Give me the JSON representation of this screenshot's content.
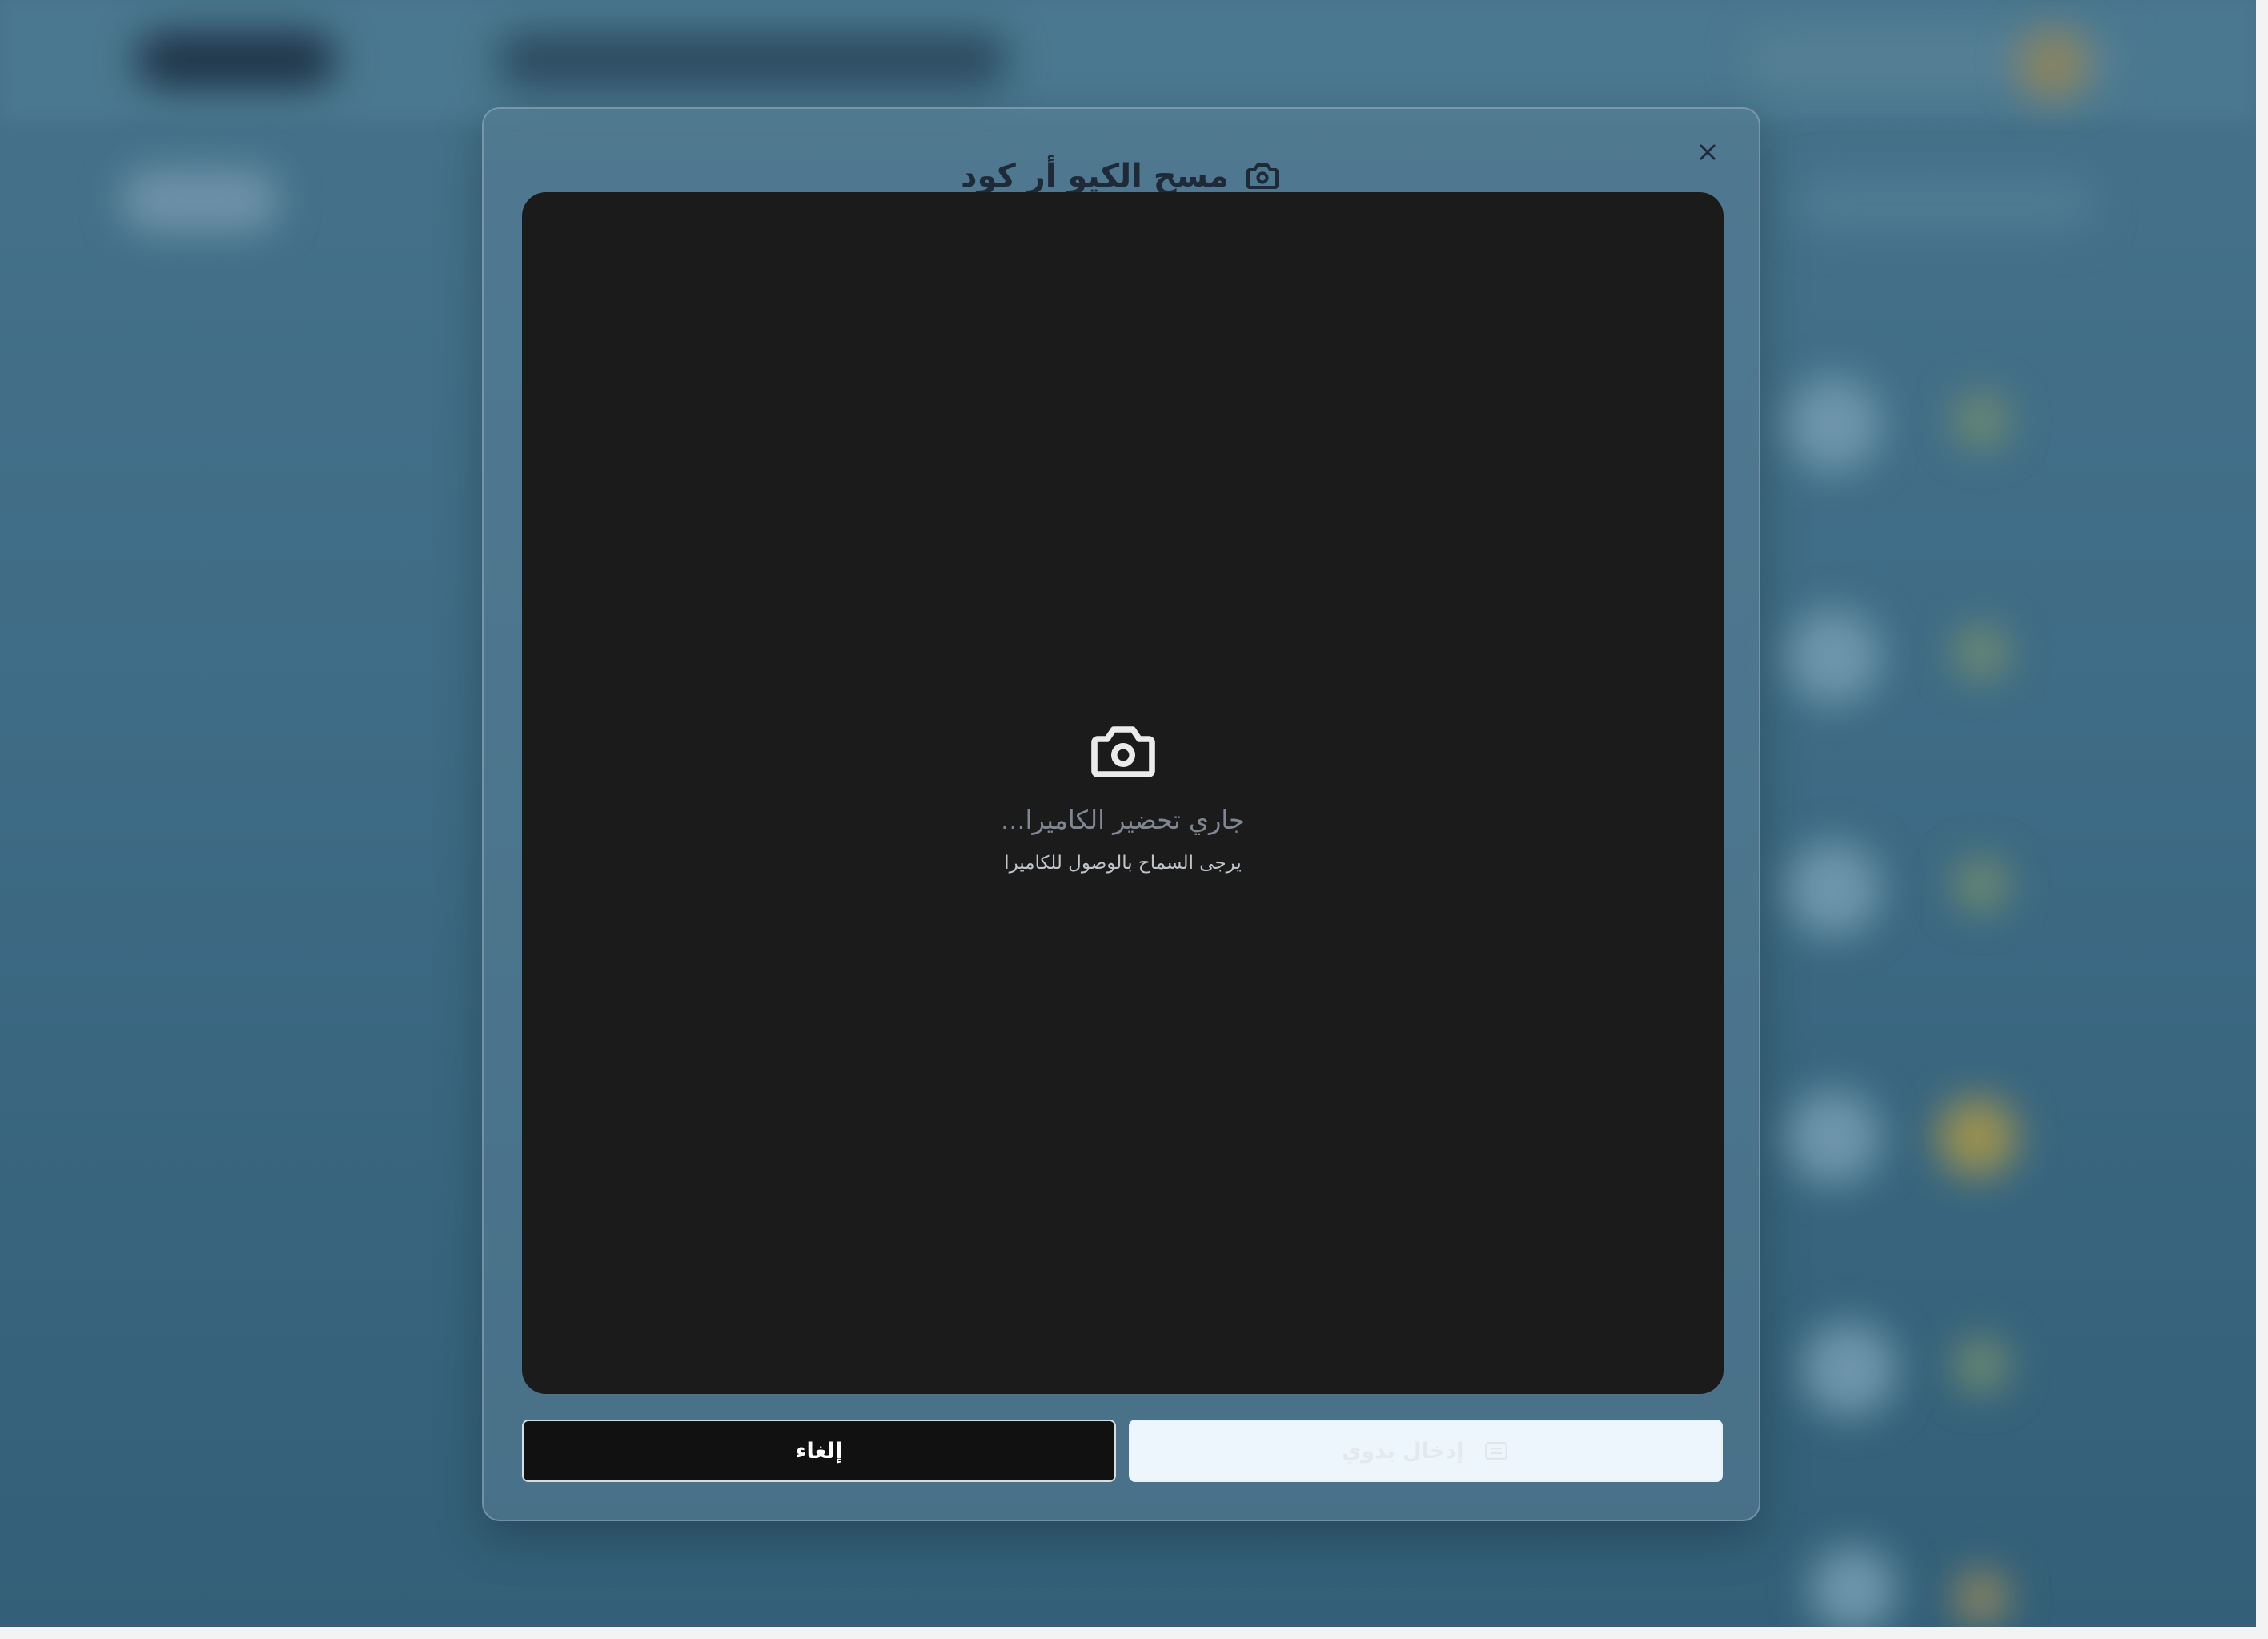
{
  "modal": {
    "title": "مسح الكيو أر كود",
    "title_icon": "camera-icon",
    "close_icon": "close-icon",
    "camera_view": {
      "icon": "camera-icon",
      "status_text": "...جاري تحضير الكاميرا",
      "hint_text": "يرجى السماح بالوصول للكاميرا"
    },
    "buttons": {
      "cancel_label": "إلغاء",
      "manual_entry_label": "إدخال يدوي",
      "manual_entry_icon": "keyboard-icon"
    }
  },
  "colors": {
    "overlay_background": "#3a6681",
    "camera_view_background": "#1b1b1b",
    "cancel_button_background": "#111111",
    "manual_button_background": "#edf5fd",
    "title_text": "#1e2a38"
  }
}
